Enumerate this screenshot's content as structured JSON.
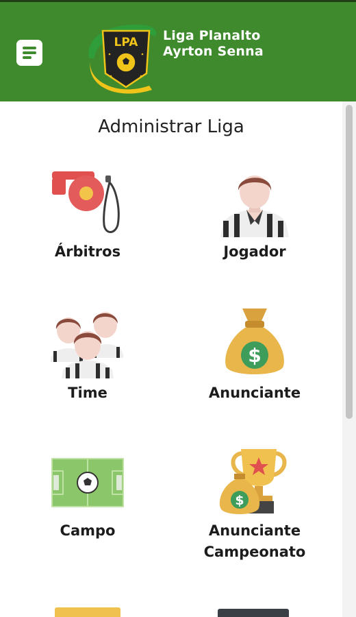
{
  "header": {
    "menu_icon": "menu-icon",
    "logo_text": "LPA",
    "brand_line1": "Liga Planalto",
    "brand_line2": "Ayrton Senna"
  },
  "page": {
    "title": "Administrar Liga"
  },
  "tiles": [
    {
      "label": "Árbitros",
      "icon": "whistle-icon"
    },
    {
      "label": "Jogador",
      "icon": "player-icon"
    },
    {
      "label": "Time",
      "icon": "team-icon"
    },
    {
      "label": "Anunciante",
      "icon": "money-bag-icon"
    },
    {
      "label": "Campo",
      "icon": "soccer-field-icon"
    },
    {
      "label": "Anunciante Campeonato",
      "icon": "trophy-money-icon"
    }
  ],
  "colors": {
    "header_bg": "#3e8a2c",
    "accent_yellow": "#e8b64a"
  }
}
